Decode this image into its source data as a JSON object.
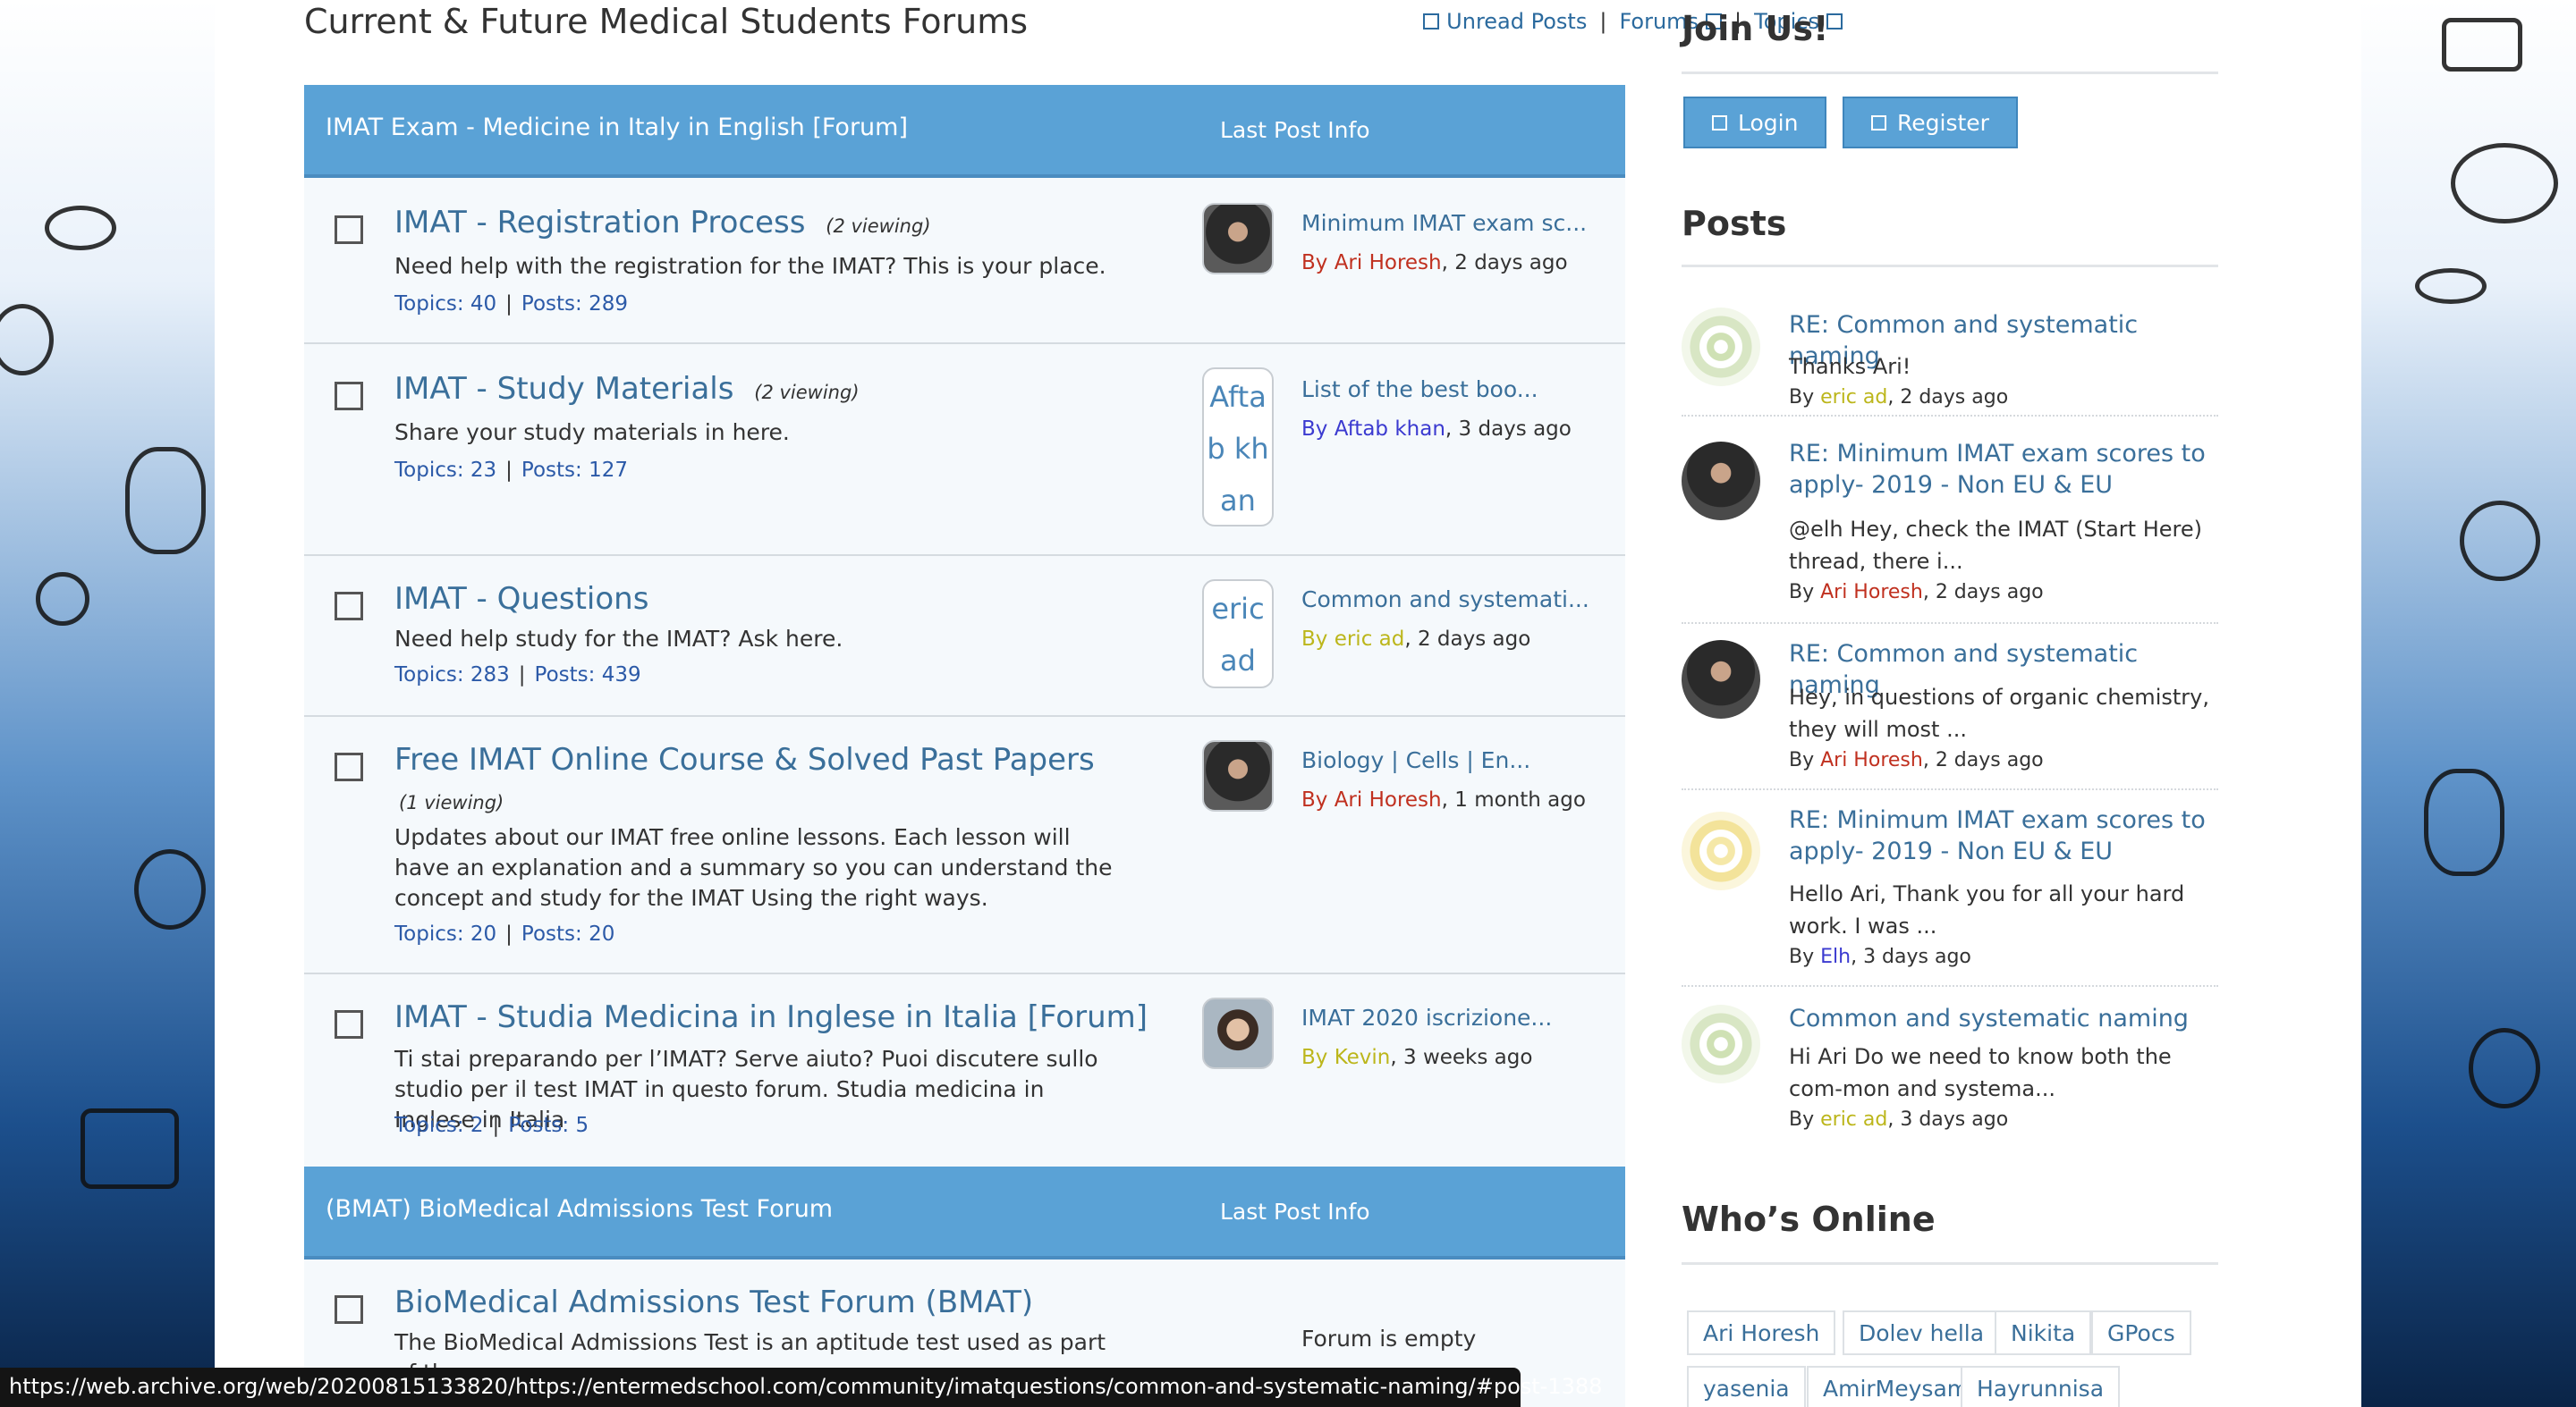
{
  "main": {
    "title": "Current & Future Medical Students Forums",
    "top_links": {
      "unread": "Unread Posts",
      "forums": "Forums",
      "topics": "Topics",
      "separator": "|"
    }
  },
  "categories": [
    {
      "name": "IMAT Exam - Medicine in Italy in English [Forum]",
      "last_post_label": "Last Post Info",
      "forums": [
        {
          "title": "IMAT - Registration Process",
          "viewing": "(2 viewing)",
          "description": "Need help with the registration for the IMAT? This is your place.",
          "topics": "Topics: 40",
          "posts": "Posts: 289",
          "last_title": "Minimum IMAT exam sc...",
          "last_user": "By Ari Horesh",
          "last_time": ", 2 days ago"
        },
        {
          "title": "IMAT - Study Materials",
          "viewing": "(2 viewing)",
          "description": "Share your study materials in here.",
          "topics": "Topics: 23",
          "posts": "Posts: 127",
          "avatar_alt": "Aftab khan",
          "last_title": "List of the best boo...",
          "last_user": "By Aftab khan",
          "last_time": ", 3 days ago"
        },
        {
          "title": "IMAT - Questions",
          "viewing": "",
          "description": "Need help study for the IMAT? Ask here.",
          "topics": "Topics: 283",
          "posts": "Posts: 439",
          "avatar_alt": "eric ad",
          "last_title": "Common and systemati...",
          "last_user": "By eric ad",
          "last_time": ", 2 days ago"
        },
        {
          "title": "Free IMAT Online Course & Solved Past Papers",
          "viewing": "(1 viewing)",
          "description": "Updates about our IMAT free online lessons. Each lesson will have an explanation and a summary so you can understand the concept and study for the IMAT Using the right ways.",
          "topics": "Topics: 20",
          "posts": "Posts: 20",
          "last_title": "Biology | Cells | En...",
          "last_user": "By Ari Horesh",
          "last_time": ", 1 month ago"
        },
        {
          "title": "IMAT - Studia Medicina in Inglese in Italia [Forum]",
          "viewing": "",
          "description": "Ti stai preparando per l’IMAT? Serve aiuto? Puoi discutere sullo studio per il test IMAT in questo forum. Studia medicina in Inglese in Italia",
          "topics": "Topics: 2",
          "posts": "Posts: 5",
          "last_title": "IMAT 2020 iscrizione...",
          "last_user": "By Kevin",
          "last_time": ", 3 weeks ago"
        }
      ]
    },
    {
      "name": "(BMAT) BioMedical Admissions Test Forum",
      "last_post_label": "Last Post Info",
      "forums": [
        {
          "title": "BioMedical Admissions Test Forum (BMAT)",
          "description": "The BioMedical Admissions Test is an aptitude test used as part of the",
          "empty": "Forum is empty"
        }
      ]
    }
  ],
  "sidebar": {
    "join_title": "Join Us!",
    "login": "Login",
    "register": "Register",
    "posts_title": "Posts",
    "posts": [
      {
        "title": "RE: Common and systematic naming",
        "text": "Thanks Ari!",
        "by": "By ",
        "user": "eric ad",
        "time": ", 2 days ago"
      },
      {
        "title": "RE: Minimum IMAT exam scores to apply- 2019 - Non EU & EU",
        "text": "@elh Hey, check the IMAT (Start Here) thread, there i...",
        "by": "By ",
        "user": "Ari Horesh",
        "time": ", 2 days ago"
      },
      {
        "title": "RE: Common and systematic naming",
        "text": "Hey, in questions of organic chemistry, they will most ...",
        "by": "By ",
        "user": "Ari Horesh",
        "time": ", 2 days ago"
      },
      {
        "title": "RE: Minimum IMAT exam scores to apply- 2019 - Non EU & EU",
        "text": "Hello Ari, Thank you for all your hard work. I was ...",
        "by": "By ",
        "user": "Elh",
        "time": ", 3 days ago"
      },
      {
        "title": "Common and systematic naming",
        "text": "Hi Ari Do we need to know both the com-mon and systema...",
        "by": "By ",
        "user": "eric ad",
        "time": ", 3 days ago"
      }
    ],
    "online_title": "Who’s Online",
    "online_users": [
      "Ari Horesh",
      "Dolev hella",
      "Nikita",
      "GPocs",
      "yasenia",
      "AmirMeysami",
      "Hayrunnisa"
    ]
  },
  "statusbar": {
    "url": "https://web.archive.org/web/20200815133820/https://entermedschool.com/community/imatquestions/common-and-systematic-naming/#post-1388"
  },
  "colors": {
    "header_blue": "#5aa2d6",
    "link_blue": "#3a6f9a",
    "user_red": "#c0301f",
    "user_purple": "#3b3ad0",
    "user_yellow": "#bcb61b"
  }
}
